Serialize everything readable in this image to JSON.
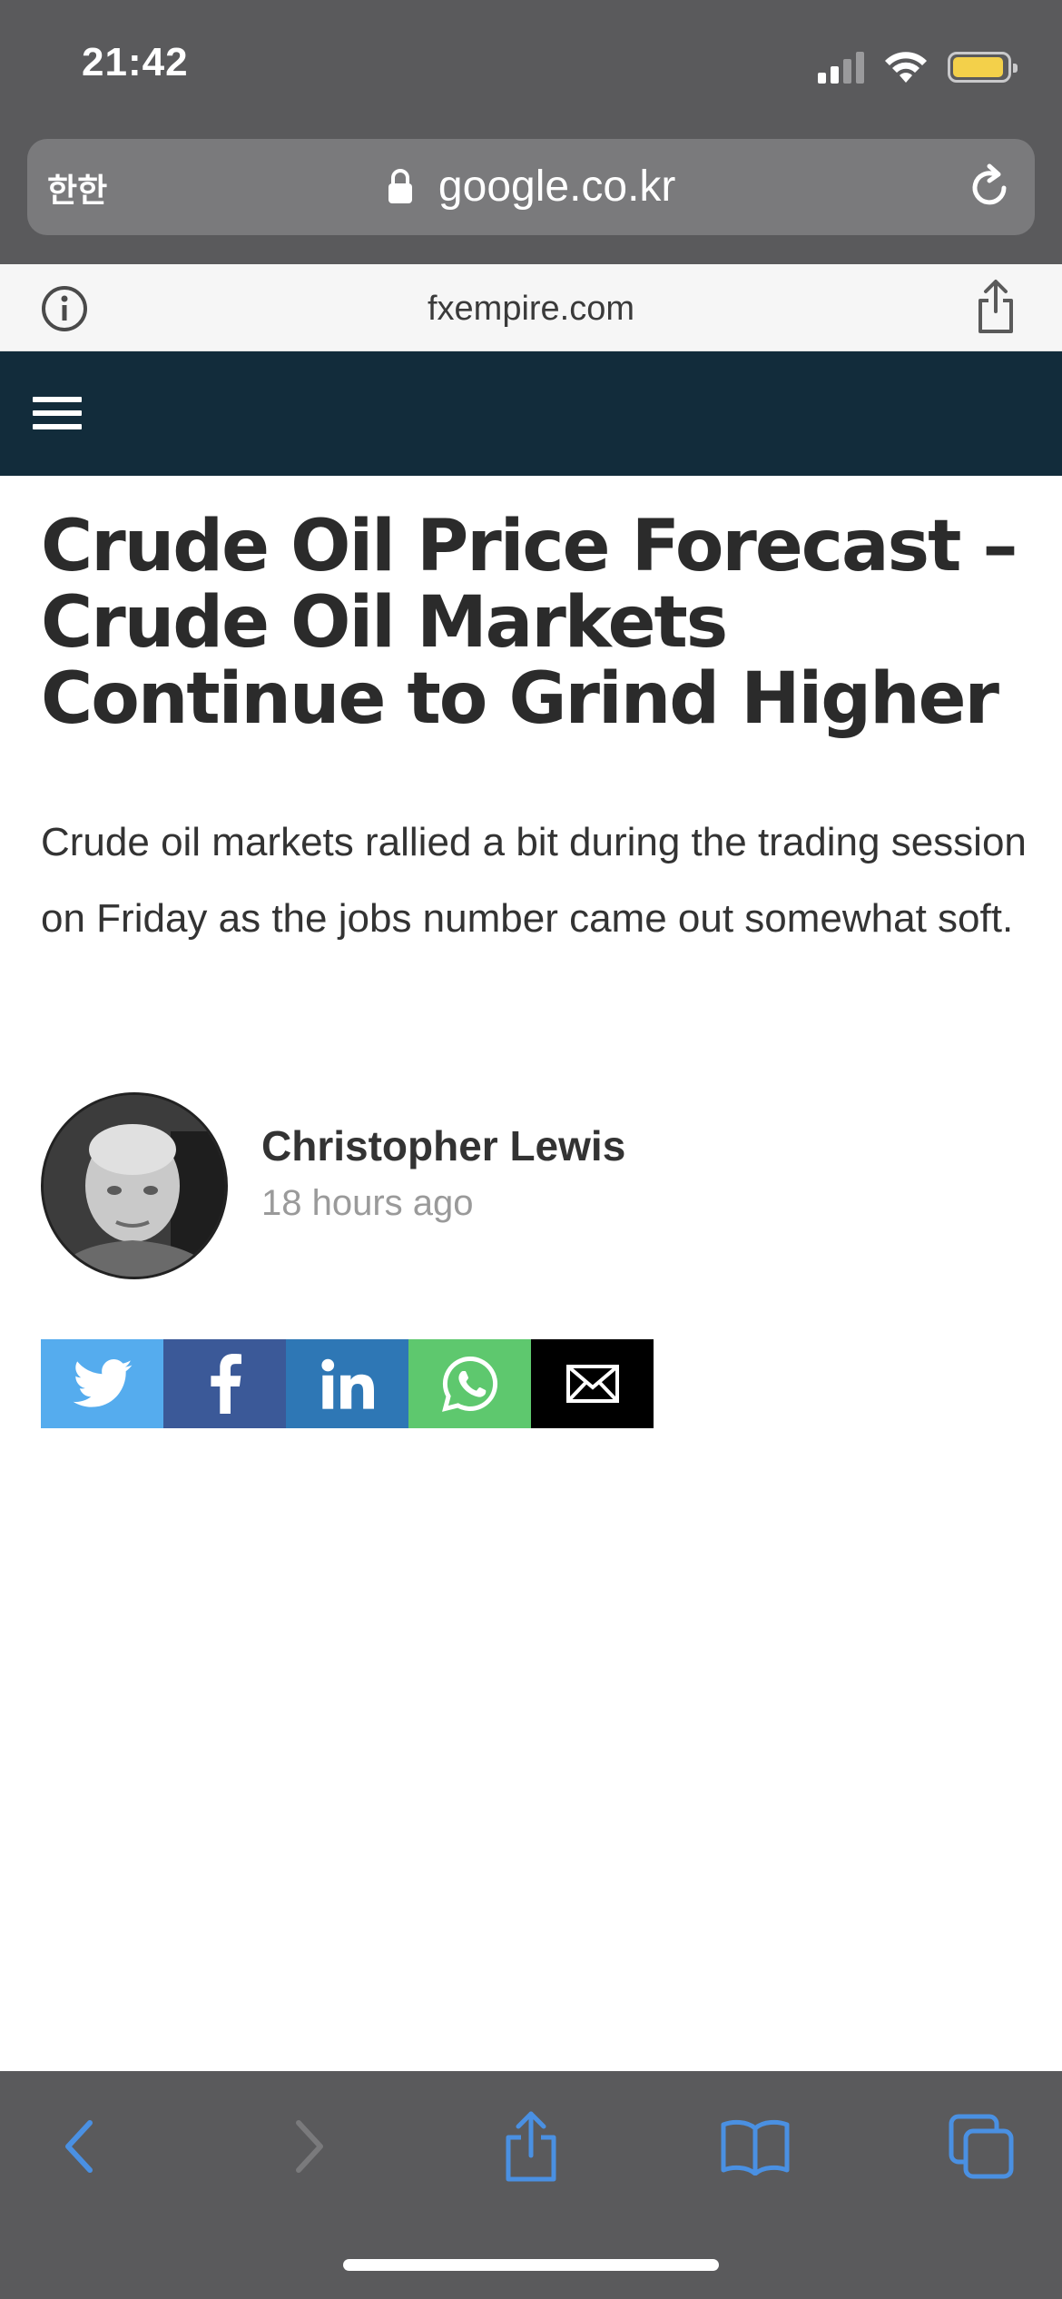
{
  "status_bar": {
    "time": "21:42"
  },
  "browser": {
    "reader_button": "한한",
    "url": "google.co.kr",
    "site_domain": "fxempire.com"
  },
  "article": {
    "title": "Crude Oil Price Forecast – Crude Oil Markets Continue to Grind Higher",
    "summary": "Crude oil markets rallied a bit during the trading session on Friday as the jobs number came out somewhat soft.",
    "author_name": "Christopher Lewis",
    "published": "18 hours ago"
  },
  "share_buttons": [
    {
      "name": "twitter",
      "icon": "twitter-bird-icon",
      "color": "#55acee"
    },
    {
      "name": "facebook",
      "icon": "facebook-f-icon",
      "color": "#3b5998"
    },
    {
      "name": "linkedin",
      "icon": "linkedin-in-icon",
      "color": "#2e77b5"
    },
    {
      "name": "whatsapp",
      "icon": "whatsapp-icon",
      "color": "#5ec86e"
    },
    {
      "name": "email",
      "icon": "envelope-icon",
      "color": "#000000"
    }
  ],
  "toolbar": {
    "icons": [
      "chevron-left-icon",
      "chevron-right-icon",
      "share-icon",
      "bookmarks-icon",
      "tabs-icon"
    ],
    "accent_color": "#4a90e2"
  },
  "colors": {
    "browser_chrome": "#5a5a5c",
    "site_header": "#122c3b",
    "battery": "#f3d04a"
  }
}
